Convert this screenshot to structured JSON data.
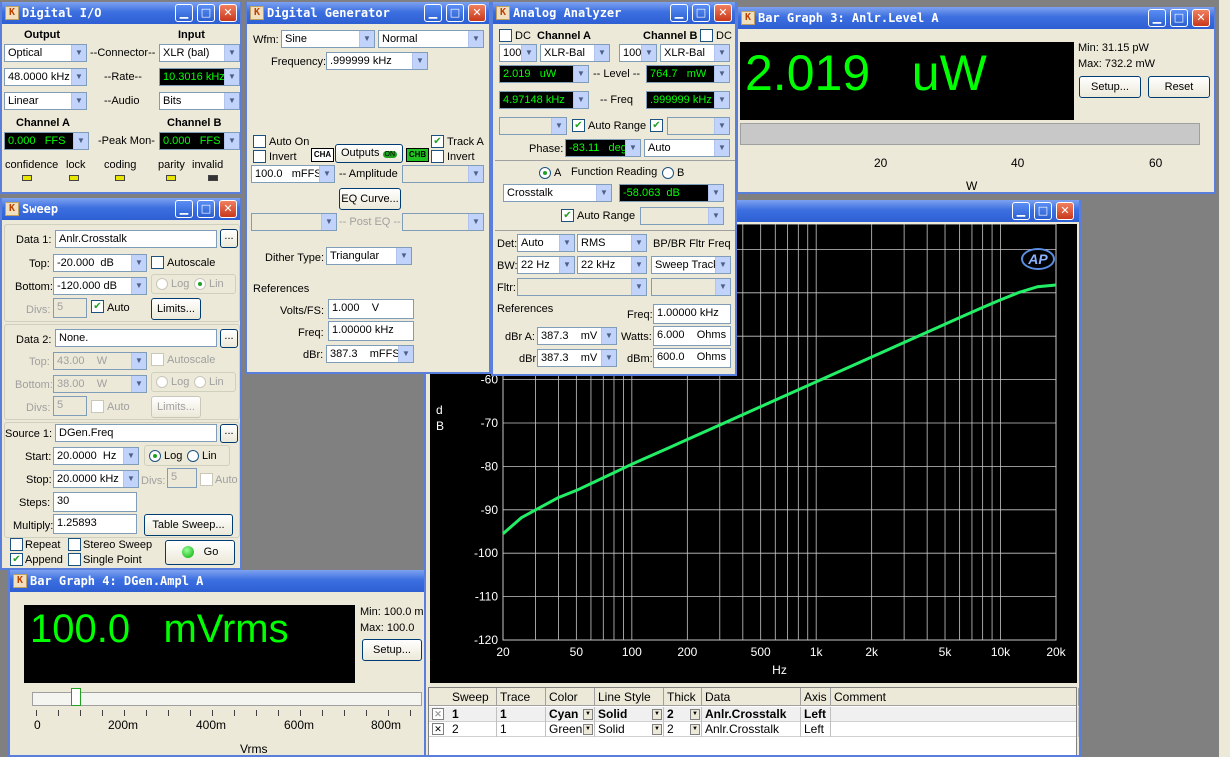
{
  "digital_io": {
    "title": "Digital I/O",
    "output": "Output",
    "input": "Input",
    "out_connector": "Optical",
    "connector": "--Connector--",
    "in_connector": "XLR (bal)",
    "out_rate": "48.0000 kHz",
    "rate": "--Rate--",
    "in_rate": "10.3016 kHz",
    "out_audio": "Linear",
    "audio": "--Audio",
    "in_audio": "Bits",
    "cha": "Channel A",
    "chb": "Channel B",
    "cha_val": "0.000   FFS",
    "peak": "-Peak Mon-",
    "chb_val": "0.000   FFS",
    "led_labels": [
      "confidence",
      "lock",
      "coding",
      "parity",
      "invalid"
    ]
  },
  "digital_generator": {
    "title": "Digital Generator",
    "wfm": "Wfm:",
    "wfm_val": "Sine",
    "mode": "Normal",
    "freq": "Frequency:",
    "freq_val": ".999999 kHz",
    "auto_on": "Auto On",
    "invert": "Invert",
    "track_a": "Track A",
    "invert_b": "Invert",
    "cha": "CHA",
    "outputs": "Outputs",
    "on": "ON",
    "chb": "CHB",
    "ampl_val": "100.0   mFFS",
    "amplitude": "-- Amplitude",
    "eq": "EQ Curve...",
    "post_eq": "-- Post EQ --",
    "dither": "Dither Type:",
    "dither_val": "Triangular",
    "refs": "References",
    "vfs": "Volts/FS:",
    "vfs_val": "1.000    V",
    "rfreq": "Freq:",
    "rfreq_val": "1.00000 kHz",
    "dbr": "dBr:",
    "dbr_val": "387.3    mFFS"
  },
  "analog_analyzer": {
    "title": "Analog Analyzer",
    "dc": "DC",
    "cha": "Channel A",
    "chb": "Channel B",
    "dc2": "DC",
    "range_a": "100l",
    "input_a": "XLR-Bal",
    "range_b": "100l",
    "input_b": "XLR-Bal",
    "level_a": "2.019   uW",
    "level": "-- Level --",
    "level_b": "764.7   mW",
    "freq_a": "4.97148 kHz",
    "freq": "-- Freq",
    "freq_b": ".999999 kHz",
    "autorange": "Auto Range",
    "phase": "Phase:",
    "phase_val": "-83.11   deg",
    "phase_mode": "Auto",
    "a": "A",
    "func_reading": "Function Reading",
    "b": "B",
    "func": "Crosstalk",
    "func_val": "-58.063  dB",
    "autorange2": "Auto Range",
    "det": "Det:",
    "det_val": "Auto",
    "det_mode": "RMS",
    "bpbr": "BP/BR Fltr Freq",
    "bw": "BW:",
    "bw_lo": "22 Hz",
    "bw_hi": "22 kHz",
    "bp_val": "Sweep Track",
    "fltr": "Fltr:",
    "refs": "References",
    "rfreq": "Freq:",
    "rfreq_val": "1.00000 kHz",
    "dbra": "dBr A:",
    "dbra_val": "387.3    mV",
    "watts": "Watts:",
    "watts_val": "6.000    Ohms",
    "dbrb": "dBr:",
    "dbrb_val": "387.3    mV",
    "dbm": "dBm:",
    "dbm_val": "600.0    Ohms"
  },
  "bar3": {
    "title": "Bar Graph 3: Anlr.Level A",
    "value": "2.019   uW",
    "min": "Min: 31.15   pW",
    "max": "Max: 732.2   mW",
    "setup": "Setup...",
    "reset": "Reset",
    "ticks": [
      "20",
      "40",
      "60"
    ],
    "unit": "W"
  },
  "sweep": {
    "title": "Sweep",
    "data1": "Data 1:",
    "data1_val": "Anlr.Crosstalk",
    "top": "Top:",
    "top_val": "-20.000  dB",
    "autoscale": "Autoscale",
    "bottom": "Bottom:",
    "bottom_val": "-120.000 dB",
    "log": "Log",
    "lin": "Lin",
    "divs": "Divs:",
    "divs_val": "5",
    "auto": "Auto",
    "limits": "Limits...",
    "data2": "Data 2:",
    "data2_val": "None.",
    "top2_val": "43.00    W",
    "autoscale2": "Autoscale",
    "bottom2_val": "38.00    W",
    "log2": "Log",
    "lin2": "Lin",
    "divs2_val": "5",
    "auto2": "Auto",
    "limits2": "Limits...",
    "source": "Source 1:",
    "source_val": "DGen.Freq",
    "start": "Start:",
    "start_val": "20.0000  Hz",
    "log3": "Log",
    "lin3": "Lin",
    "stop": "Stop:",
    "stop_val": "20.0000 kHz",
    "divs3": "Divs:",
    "divs3_val": "5",
    "auto3": "Auto",
    "steps": "Steps:",
    "steps_val": "30",
    "multiply": "Multiply:",
    "multiply_val": "1.25893",
    "table_sweep": "Table Sweep...",
    "repeat": "Repeat",
    "stereo": "Stereo Sweep",
    "append": "Append",
    "single": "Single Point",
    "go": "Go"
  },
  "bar4": {
    "title": "Bar Graph 4: DGen.Ampl A",
    "value": "100.0   mVrms",
    "min": "Min: 100.0   m",
    "max": "Max: 100.0",
    "setup": "Setup...",
    "ticks": [
      "0",
      "200m",
      "400m",
      "600m",
      "800m"
    ],
    "unit": "Vrms"
  },
  "graph": {
    "logo": "AP",
    "ylabel_d": "d",
    "ylabel_b": "B",
    "xlabel": "Hz",
    "legend_headers": [
      "Sweep",
      "Trace",
      "Color",
      "Line Style",
      "Thick",
      "Data",
      "Axis",
      "Comment"
    ],
    "legend_rows": [
      [
        "1",
        "1",
        "Cyan",
        "Solid",
        "2",
        "Anlr.Crosstalk",
        "Left",
        ""
      ],
      [
        "2",
        "1",
        "Green",
        "Solid",
        "2",
        "Anlr.Crosstalk",
        "Left",
        ""
      ]
    ]
  },
  "chart_data": {
    "type": "line",
    "xlabel": "Hz",
    "ylabel": "dB",
    "x_scale": "log",
    "xlim": [
      20,
      20000
    ],
    "ylim": [
      -120,
      -20
    ],
    "x_ticks": [
      "20",
      "50",
      "100",
      "200",
      "500",
      "1k",
      "2k",
      "5k",
      "10k",
      "20k"
    ],
    "y_ticks": [
      "-60",
      "-70",
      "-80",
      "-90",
      "-100",
      "-110",
      "-120"
    ],
    "series": [
      {
        "name": "Anlr.Crosstalk",
        "color": "#22ee66",
        "x": [
          20,
          25.2,
          31.7,
          39.9,
          50.2,
          63.2,
          79.6,
          100,
          126,
          159,
          200,
          252,
          317,
          399,
          502,
          632,
          796,
          1002,
          1262,
          1589,
          2000,
          2518,
          3170,
          3991,
          5024,
          6325,
          7962,
          10024,
          12619,
          15887,
          20000
        ],
        "y": [
          -95.5,
          -91.8,
          -89.5,
          -87.2,
          -85.5,
          -83.5,
          -81.5,
          -79.5,
          -77.6,
          -75.7,
          -73.8,
          -71.9,
          -70.0,
          -68.1,
          -66.2,
          -64.3,
          -62.4,
          -60.5,
          -58.6,
          -56.7,
          -54.8,
          -52.9,
          -51.0,
          -49.1,
          -47.2,
          -45.3,
          -43.4,
          -41.6,
          -39.9,
          -38.6,
          -38.2
        ]
      }
    ]
  }
}
